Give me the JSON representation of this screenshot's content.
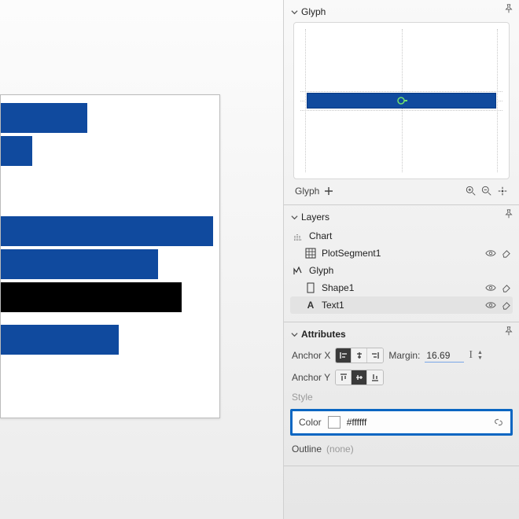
{
  "chart_data": {
    "type": "bar",
    "orientation": "horizontal",
    "values": [
      110,
      40,
      270,
      200,
      230,
      150
    ],
    "highlighted_index": 4,
    "colors": {
      "default": "#104a9e",
      "highlight": "#000000"
    },
    "title": "",
    "xlabel": "",
    "ylabel": "",
    "xlim": [
      0,
      280
    ]
  },
  "panels": {
    "glyph": {
      "title": "Glyph",
      "footer_label": "Glyph"
    },
    "layers": {
      "title": "Layers",
      "items": [
        {
          "label": "Chart"
        },
        {
          "label": "PlotSegment1"
        },
        {
          "label": "Glyph"
        },
        {
          "label": "Shape1"
        },
        {
          "label": "Text1"
        }
      ]
    },
    "attributes": {
      "title": "Attributes",
      "anchor_x_label": "Anchor X",
      "anchor_y_label": "Anchor Y",
      "margin_label": "Margin:",
      "margin_value": "16.69",
      "style_label": "Style",
      "color_label": "Color",
      "color_value": "#ffffff",
      "outline_label": "Outline",
      "outline_value": "(none)"
    }
  }
}
